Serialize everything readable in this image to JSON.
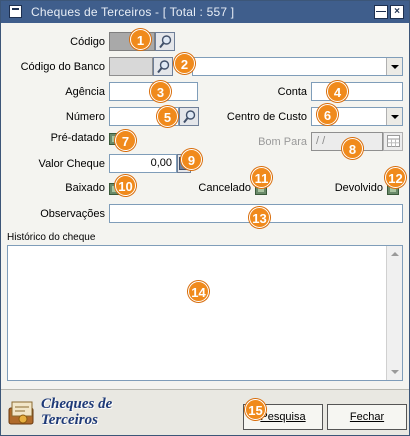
{
  "window": {
    "title": "Cheques de Terceiros - [ Total : 557 ]"
  },
  "form": {
    "codigo_label": "Código",
    "codigo_banco_label": "Código do Banco",
    "agencia_label": "Agência",
    "conta_label": "Conta",
    "numero_label": "Número",
    "centro_custo_label": "Centro de Custo",
    "pre_datado_label": "Pré-datado",
    "bom_para_label": "Bom Para",
    "bom_para_value": " / /",
    "valor_cheque_label": "Valor Cheque",
    "valor_cheque_value": "0,00",
    "baixado_label": "Baixado",
    "cancelado_label": "Cancelado",
    "devolvido_label": "Devolvido",
    "observacoes_label": "Observações",
    "historico_label": "Histórico do cheque"
  },
  "badges": [
    "1",
    "2",
    "3",
    "4",
    "5",
    "6",
    "7",
    "8",
    "9",
    "10",
    "11",
    "12",
    "13",
    "14",
    "15"
  ],
  "footer": {
    "brand_line1": "Cheques de",
    "brand_line2": "Terceiros",
    "pesquisa_label": "Pesquisa",
    "fechar_label": "Fechar"
  },
  "icons": {
    "lookup": "magnifier-icon",
    "calendar": "calendar-icon",
    "calculator": "calculator-icon",
    "logo": "checkbook-logo-icon"
  },
  "colors": {
    "titlebar": "#3f5e8c",
    "badge": "#f08a1c",
    "brand_text": "#1e3a78"
  }
}
